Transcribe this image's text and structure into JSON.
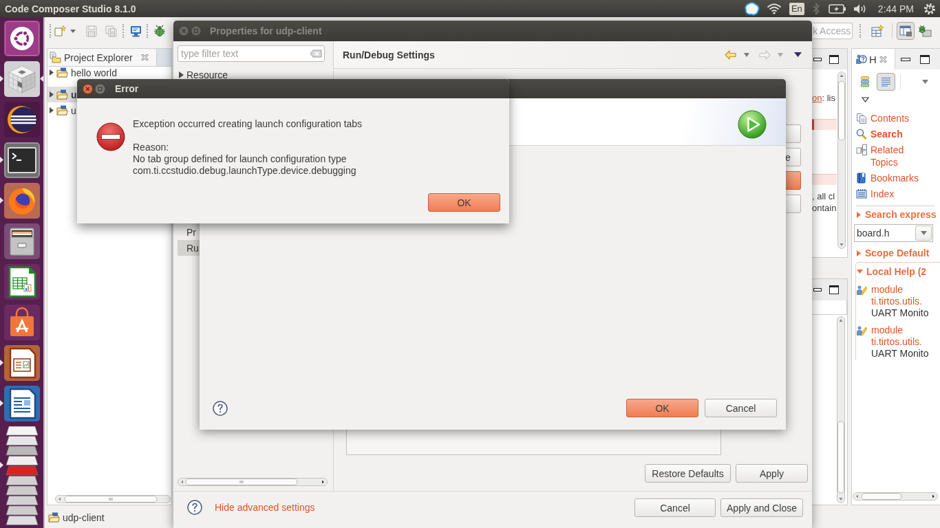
{
  "top_panel": {
    "title": "Code Composer Studio 8.1.0",
    "keyboard_layout": "En",
    "clock": "2:44 PM"
  },
  "launcher": {
    "items": [
      {
        "running": false,
        "focused": false
      },
      {
        "running": true,
        "focused": true
      },
      {
        "running": false,
        "focused": false
      },
      {
        "running": true,
        "focused": false
      },
      {
        "running": true,
        "focused": false
      },
      {
        "running": false,
        "focused": false
      },
      {
        "running": false,
        "focused": false
      },
      {
        "running": false,
        "focused": false
      },
      {
        "running": true,
        "focused": false
      },
      {
        "running": true,
        "focused": false
      },
      {
        "running": true,
        "focused": false
      }
    ]
  },
  "ide": {
    "toolbar": {
      "buttons": [
        {
          "disabled": false
        },
        {
          "disabled": true
        },
        {
          "disabled": true
        },
        {
          "disabled": false
        },
        {
          "disabled": false
        }
      ]
    },
    "quick_access": {
      "placeholder": "k Access"
    },
    "perspective_buttons": [
      {
        "selected": true
      },
      {
        "selected": false
      }
    ],
    "project_explorer": {
      "tab": "Project Explorer",
      "items": [
        {
          "label": "hello world",
          "selected": false
        },
        {
          "label": "u",
          "selected": true
        },
        {
          "label": "u",
          "selected": false
        }
      ]
    },
    "editor": {
      "blocks": [
        {
          "lines": [
            {
              "link": "on",
              "text": ": lis"
            }
          ]
        },
        {
          "lines": [
            {
              "text": ", all cl"
            },
            {
              "text": "ontain"
            }
          ]
        }
      ]
    },
    "help": {
      "tab": "H",
      "view_toggles": [
        {
          "selected": false
        },
        {
          "selected": true
        }
      ],
      "links": [
        {
          "label": "Contents",
          "selected": false
        },
        {
          "label": "Search",
          "selected": true
        },
        {
          "label": "Related Topics",
          "selected": false
        },
        {
          "label": "Bookmarks",
          "selected": false
        },
        {
          "label": "Index",
          "selected": false
        }
      ],
      "sections": [
        {
          "title": "Search express",
          "expanded": false,
          "field": "board.h"
        },
        {
          "title": "Scope Default",
          "expanded": false
        },
        {
          "title": "Local Help (2",
          "expanded": true,
          "results": [
            {
              "title": "module ti.tirtos.utils.",
              "description": "UART Monito"
            },
            {
              "title": "module ti.tirtos.utils.",
              "description": "UART Monito"
            }
          ]
        }
      ]
    },
    "status_bar": {
      "text": "udp-client"
    }
  },
  "properties_dialog": {
    "title": "Properties for udp-client",
    "active": false,
    "filter": {
      "placeholder": "type filter text"
    },
    "tree": [
      {
        "label": "Resource",
        "expandable": true,
        "selected": false
      },
      {
        "label": "Pr",
        "expandable": false,
        "selected": false
      },
      {
        "label": "Ru",
        "expandable": false,
        "selected": true
      }
    ],
    "page_title": "Run/Debug Settings",
    "nav": [
      {
        "disabled": false
      },
      {
        "disabled": true
      }
    ],
    "side_buttons": [
      {
        "default": false
      },
      {
        "label": "e",
        "default": false
      },
      {
        "default": true
      },
      {
        "default": false
      }
    ],
    "page_buttons": [
      {
        "label": "Restore Defaults",
        "default": false
      },
      {
        "label": "Apply",
        "default": false
      }
    ],
    "footer_link": "Hide advanced settings",
    "buttons": [
      {
        "label": "Cancel",
        "default": false
      },
      {
        "label": "Apply and Close",
        "default": false
      }
    ]
  },
  "launch_dialog": {
    "buttons": [
      {
        "label": "OK",
        "default": true
      },
      {
        "label": "Cancel",
        "default": false
      }
    ]
  },
  "error_dialog": {
    "title": "Error",
    "active": true,
    "message": "Exception occurred creating launch configuration tabs",
    "details": [
      "Reason:",
      "No tab group defined for launch configuration type",
      "com.ti.ccstudio.debug.launchType.device.debugging"
    ],
    "buttons": [
      {
        "label": "OK",
        "default": true
      }
    ]
  }
}
